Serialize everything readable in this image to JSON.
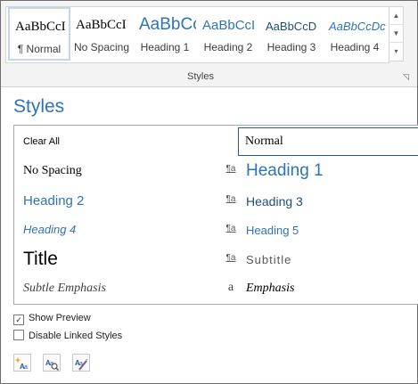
{
  "ribbon": {
    "gallery": [
      {
        "sample": "AaBbCcI",
        "name": "¶ Normal",
        "selected": true
      },
      {
        "sample": "AaBbCcI",
        "name": "No Spacing"
      },
      {
        "sample": "AaBbCc",
        "name": "Heading 1"
      },
      {
        "sample": "AaBbCcI",
        "name": "Heading 2"
      },
      {
        "sample": "AaBbCcD",
        "name": "Heading 3"
      },
      {
        "sample": "AaBbCcDc",
        "name": "Heading 4"
      }
    ],
    "group_label": "Styles",
    "scroll_up": "▲",
    "scroll_down": "▼",
    "more": "▾",
    "launcher": "◹"
  },
  "pane": {
    "title": "Styles",
    "styles": {
      "clear_all": "Clear All",
      "normal": "Normal",
      "no_spacing": "No Spacing",
      "heading1": "Heading 1",
      "heading2": "Heading 2",
      "heading3": "Heading 3",
      "heading4": "Heading 4",
      "heading5": "Heading 5",
      "title": "Title",
      "subtitle": "Subtitle",
      "subtle_emphasis": "Subtle Emphasis",
      "emphasis": "Emphasis"
    },
    "marks": {
      "paragraph": "¶a",
      "character": "a"
    },
    "show_preview": {
      "label": "Show Preview",
      "checked": true,
      "glyph": "✓"
    },
    "disable_linked": {
      "label": "Disable Linked Styles",
      "checked": false
    }
  },
  "colors": {
    "heading": "#2e74b5",
    "accent_border": "#2b579a"
  }
}
